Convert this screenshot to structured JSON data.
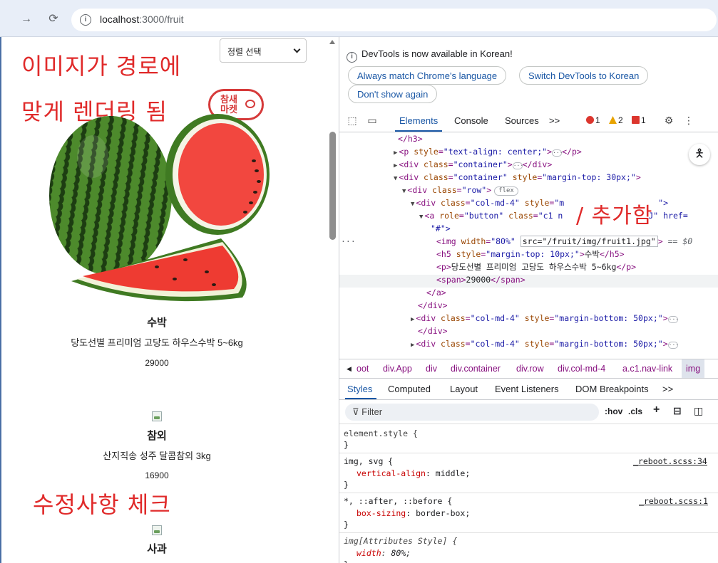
{
  "browser": {
    "url_host": "localhost",
    "url_path": ":3000/fruit"
  },
  "page": {
    "sort_select": "정렬 선택",
    "annotations": {
      "line1": "이미지가 경로에",
      "line2": "맞게 렌더링 됨",
      "check": "수정사항 체크",
      "added": "/ 추가함"
    },
    "logo_text": "참새\n마켓",
    "products": [
      {
        "name": "수박",
        "desc": "당도선별 프리미엄 고당도 하우스수박 5~6kg",
        "price": "29000"
      },
      {
        "name": "참외",
        "desc": "산지직송 성주 달콤참외 3kg",
        "price": "16900"
      },
      {
        "name": "사과",
        "desc": "",
        "price": ""
      }
    ]
  },
  "devtools": {
    "banner": "DevTools is now available in Korean!",
    "buttons": [
      "Always match Chrome's language",
      "Switch DevTools to Korean",
      "Don't show again"
    ],
    "tabs": [
      "Elements",
      "Console",
      "Sources"
    ],
    "more": ">>",
    "errors": "1",
    "warnings": "2",
    "issues": "1",
    "tree": [
      {
        "t": "</h3>"
      },
      {
        "tag": "<p ",
        "an": "style",
        "av": "\"text-align: center;\"",
        "rest": ">",
        "dots": true,
        "close": "</p>"
      },
      {
        "tag": "<div ",
        "an": "class",
        "av": "\"container\"",
        "rest": ">",
        "dots": true,
        "close": "</div>"
      },
      {
        "tag": "<div ",
        "an": "class",
        "av": "\"container\"",
        "an2": "style",
        "av2": "\"margin-top: 30px;\"",
        "rest": ">"
      },
      {
        "tag": "<div ",
        "an": "class",
        "av": "\"row\"",
        "rest": ">",
        "badge": "flex"
      },
      {
        "tag": "<div ",
        "an": "class",
        "av": "\"col-md-4\"",
        "an2": "style",
        "av2": "\"m",
        "rest2": "\">"
      },
      {
        "tag": "<a ",
        "an": "role",
        "av": "\"button\"",
        "an2": "class",
        "av2": "\"c1 n",
        "rest2": "J\" href="
      },
      {
        "t": "\"#\">"
      },
      {
        "tag": "<img ",
        "an": "width",
        "av": "\"80%\"",
        "src": "src=\"/fruit/img/fruit1.jpg\"",
        "rest": ">",
        "eq": "== $0"
      },
      {
        "tag": "<h5 ",
        "an": "style",
        "av": "\"margin-top: 10px;\"",
        "rest": ">",
        "text": "수박",
        "close": "</h5>"
      },
      {
        "tag": "<p>",
        "text": "당도선별 프리미엄 고당도 하우스수박 5~6kg",
        "close": "</p>"
      },
      {
        "tag": "<span>",
        "text": "29000",
        "close": "</span>"
      },
      {
        "t": "</a>"
      },
      {
        "t": "</div>"
      },
      {
        "tag": "<div ",
        "an": "class",
        "av": "\"col-md-4\"",
        "an2": "style",
        "av2": "\"margin-bottom: 50px;\"",
        "rest": ">",
        "dots": true
      },
      {
        "t": "</div>"
      },
      {
        "tag": "<div ",
        "an": "class",
        "av": "\"col-md-4\"",
        "an2": "style",
        "av2": "\"margin-bottom: 50px;\"",
        "rest": ">",
        "dots": true
      }
    ],
    "breadcrumbs": [
      "oot",
      "div.App",
      "div",
      "div.container",
      "div.row",
      "div.col-md-4",
      "a.c1.nav-link",
      "img"
    ],
    "style_tabs": [
      "Styles",
      "Computed",
      "Layout",
      "Event Listeners",
      "DOM Breakpoints"
    ],
    "filter_placeholder": "Filter",
    "hov": ":hov",
    "cls": ".cls",
    "rules": {
      "element_style": "element.style {",
      "r1_selector": "img, svg {",
      "r1_source": "_reboot.scss:34",
      "r1_prop": "vertical-align",
      "r1_val": "middle;",
      "r2_selector": "*, ::after, ::before {",
      "r2_source": "_reboot.scss:1",
      "r2_prop": "box-sizing",
      "r2_val": "border-box;",
      "r3_selector": "img[Attributes Style] {",
      "r3_prop": "width",
      "r3_val": "80%;",
      "close": "}"
    }
  }
}
